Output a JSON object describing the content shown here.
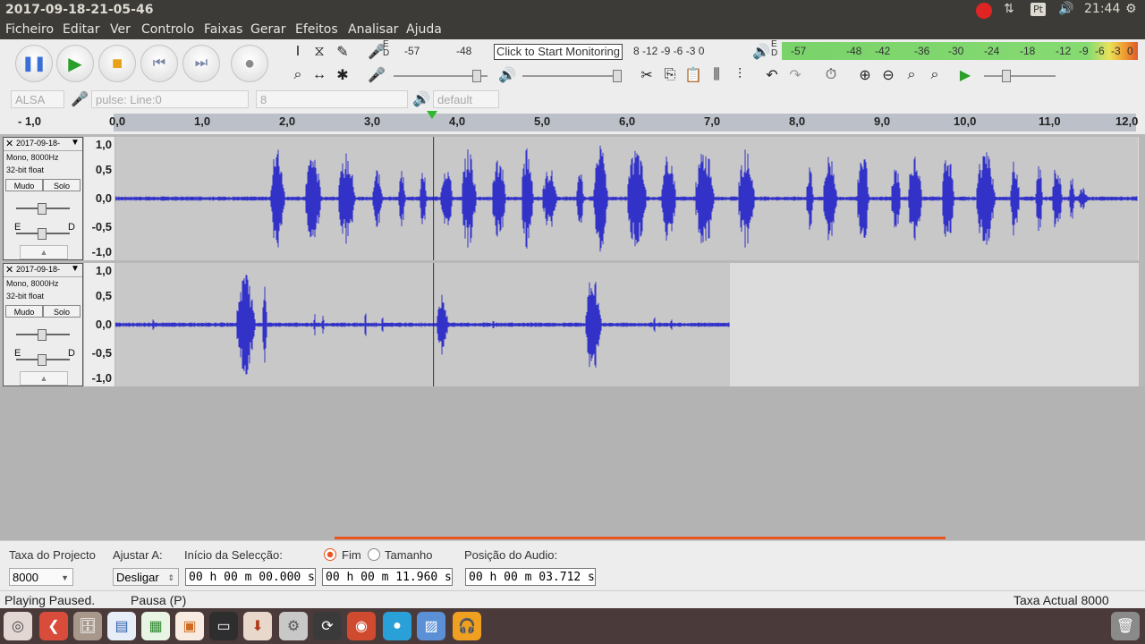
{
  "window": {
    "title": "2017-09-18-21-05-46"
  },
  "tray": {
    "lang": "Pt",
    "time": "21:44"
  },
  "menu": [
    "Ficheiro",
    "Editar",
    "Ver",
    "Controlo",
    "Faixas",
    "Gerar",
    "Efeitos",
    "Analisar",
    "Ajuda"
  ],
  "meters": {
    "record_scale": [
      "-57",
      "-48"
    ],
    "monitor_label": "Click to Start Monitoring",
    "record_scale_right": "8  -12 -9 -6 -3 0",
    "play_scale": [
      "-57",
      "-48",
      "-42",
      "-36",
      "-30",
      "-24",
      "-18",
      "-12",
      "-9",
      "-6",
      "-3",
      "0"
    ],
    "record_lr": [
      "E",
      "D"
    ],
    "play_lr": [
      "E",
      "D"
    ]
  },
  "devices": {
    "host": "ALSA",
    "input": "pulse: Line:0",
    "channels": "8",
    "output": "default"
  },
  "ruler": {
    "ticks": [
      "- 1,0",
      "0,0",
      "1,0",
      "2,0",
      "3,0",
      "4,0",
      "5,0",
      "6,0",
      "7,0",
      "8,0",
      "9,0",
      "10,0",
      "11,0",
      "12,0"
    ],
    "cursor_seconds": 3.712
  },
  "tracks": [
    {
      "name": "2017-09-18-",
      "format": "Mono, 8000Hz",
      "depth": "32-bit float",
      "mute": "Mudo",
      "solo": "Solo",
      "pan_left": "E",
      "pan_right": "D",
      "scale": [
        "1,0",
        "0,5",
        "0,0",
        "-0,5",
        "-1,0"
      ],
      "duration_seconds": 12.0
    },
    {
      "name": "2017-09-18-",
      "format": "Mono, 8000Hz",
      "depth": "32-bit float",
      "mute": "Mudo",
      "solo": "Solo",
      "pan_left": "E",
      "pan_right": "D",
      "scale": [
        "1,0",
        "0,5",
        "0,0",
        "-0,5",
        "-1,0"
      ],
      "duration_seconds": 7.2
    }
  ],
  "selection": {
    "rate_label": "Taxa do Projecto",
    "rate_value": "8000",
    "snap_label": "Ajustar A:",
    "snap_value": "Desligar",
    "start_label": "Início da Selecção:",
    "end_label": "Fim",
    "length_label": "Tamanho",
    "start_value": "00 h 00 m 00.000 s",
    "end_value": "00 h 00 m 11.960 s",
    "position_label": "Posição do Audio:",
    "position_value": "00 h 00 m 03.712 s"
  },
  "status": {
    "left": "Playing Paused.",
    "middle": "Pausa (P)",
    "right": "Taxa Actual 8000"
  },
  "colors": {
    "waveform": "#3232c8",
    "track_bg": "#c8c8c8",
    "accent": "#e95420",
    "meter_green": "#7fd46a"
  }
}
